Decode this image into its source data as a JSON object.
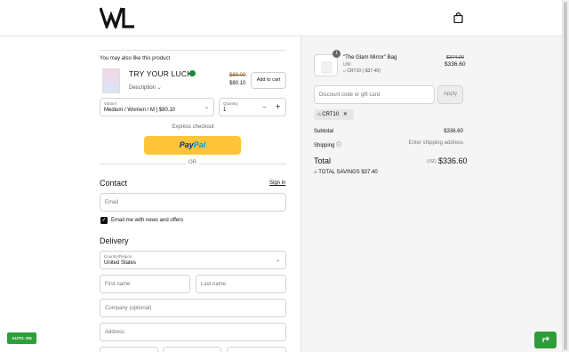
{
  "header": {
    "logo_text": "WL",
    "cart_icon": "shopping-bag-icon"
  },
  "recommendation": {
    "title": "You may also like this product",
    "product_name": "TRY YOUR LUCK",
    "description_label": "Description",
    "old_price": "$89.00",
    "price": "$80.10",
    "add_to_cart": "Add to cart",
    "variant_label": "Variant",
    "variant_value": "Medium / Women / M | $80.10",
    "quantity_label": "Quantity",
    "quantity_value": "1",
    "minus": "−",
    "plus": "+"
  },
  "express": {
    "label": "Express checkout",
    "paypal_part1": "Pay",
    "paypal_part2": "Pal",
    "or": "OR"
  },
  "contact": {
    "heading": "Contact",
    "signin": "Sign in",
    "email_placeholder": "Email",
    "newsletter_label": "Email me with news and offers",
    "newsletter_checked": true
  },
  "delivery": {
    "heading": "Delivery",
    "country_label": "Country/Region",
    "country_value": "United States",
    "first_name": "First name",
    "last_name": "Last name",
    "company": "Company (optional)",
    "address": "Address"
  },
  "floating": {
    "auto_label": "AUTO: ON"
  },
  "summary": {
    "item": {
      "quantity": "1",
      "name": "\"The Glam Mirror\" Bag",
      "variant": "UNI",
      "discount": "CRT10 (-$37.40)",
      "old_price": "$374.00",
      "price": "$336.60"
    },
    "discount_placeholder": "Discount code or gift card",
    "apply": "Apply",
    "applied_code": "CRT10",
    "subtotal_label": "Subtotal",
    "subtotal_value": "$336.60",
    "shipping_label": "Shipping",
    "shipping_value": "Enter shipping address",
    "total_label": "Total",
    "currency": "USD",
    "total_value": "$336.60",
    "savings_label": "TOTAL SAVINGS",
    "savings_value": "$37.40"
  }
}
